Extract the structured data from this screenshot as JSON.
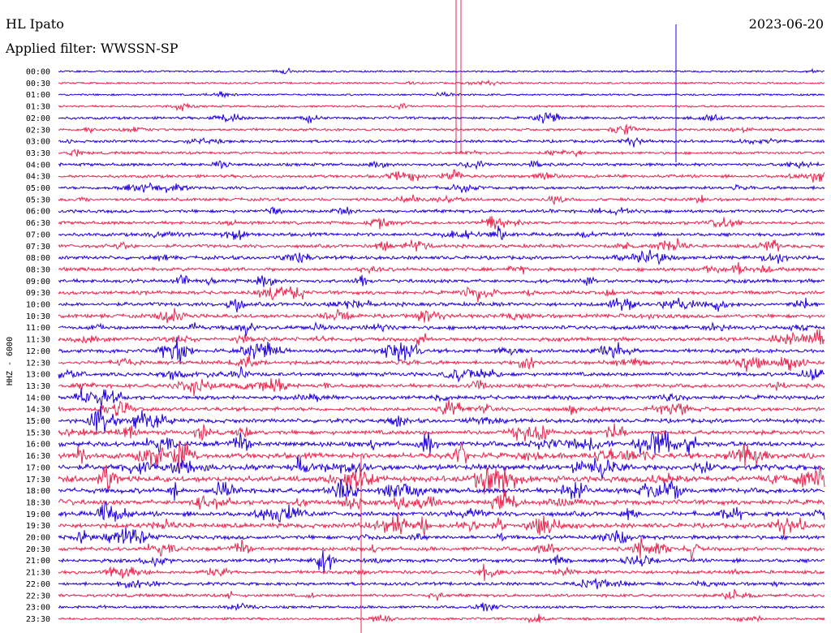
{
  "header": {
    "station": "HL Ipato",
    "filter": "Applied filter: WWSSN-SP",
    "date": "2023-06-20"
  },
  "chart_data": {
    "type": "line",
    "title": "HL Ipato",
    "subtitle": "Applied filter: WWSSN-SP",
    "ylabel": "HHZ - 6000",
    "xlabel": "",
    "date": "2023-06-20",
    "trace_labels": [
      "00:00",
      "00:30",
      "01:00",
      "01:30",
      "02:00",
      "02:30",
      "03:00",
      "03:30",
      "04:00",
      "04:30",
      "05:00",
      "05:30",
      "06:00",
      "06:30",
      "07:00",
      "07:30",
      "08:00",
      "08:30",
      "09:00",
      "09:30",
      "10:00",
      "10:30",
      "11:00",
      "11:30",
      "12:00",
      "12:30",
      "13:00",
      "13:30",
      "14:00",
      "14:30",
      "15:00",
      "15:30",
      "16:00",
      "16:30",
      "17:00",
      "17:30",
      "18:00",
      "18:30",
      "19:00",
      "19:30",
      "20:00",
      "20:30",
      "21:00",
      "21:30",
      "22:00",
      "22:30",
      "23:00",
      "23:30"
    ],
    "trace_colors": [
      "#1f00dd",
      "#e8264f"
    ],
    "trace_noise_level": [
      0.2,
      0.2,
      0.2,
      0.3,
      0.6,
      0.6,
      0.7,
      0.6,
      0.8,
      0.8,
      0.8,
      0.8,
      0.9,
      0.9,
      1.0,
      1.0,
      1.1,
      1.1,
      1.1,
      1.1,
      1.2,
      1.2,
      1.2,
      1.2,
      1.2,
      1.2,
      1.2,
      1.2,
      1.3,
      1.3,
      1.3,
      1.4,
      1.8,
      2.0,
      2.1,
      2.1,
      1.8,
      1.7,
      1.6,
      1.6,
      1.3,
      1.2,
      1.1,
      1.0,
      0.9,
      0.8,
      0.6,
      0.5
    ],
    "grid": false
  }
}
